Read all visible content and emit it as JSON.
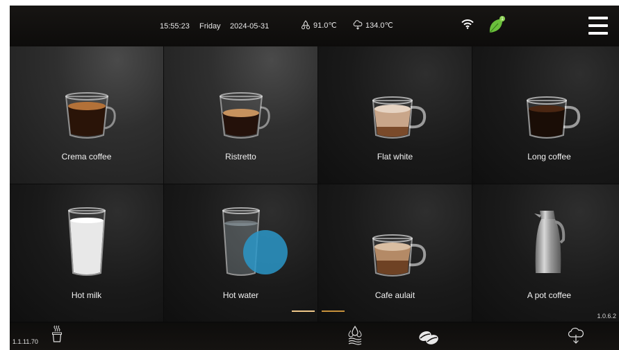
{
  "status_bar": {
    "time": "15:55:23",
    "day": "Friday",
    "date": "2024-05-31",
    "water_temp": "91.0℃",
    "steam_temp": "134.0℃",
    "icons": [
      "water-drops-icon",
      "steam-icon",
      "wifi-icon",
      "eco-leaf-icon",
      "menu-icon"
    ]
  },
  "drinks": [
    {
      "name": "Crema coffee",
      "icon": "espresso-glass-cup-icon"
    },
    {
      "name": "Ristretto",
      "icon": "ristretto-glass-cup-icon"
    },
    {
      "name": "Flat white",
      "icon": "flat-white-mug-icon"
    },
    {
      "name": "Long coffee",
      "icon": "long-coffee-mug-icon"
    },
    {
      "name": "Hot milk",
      "icon": "milk-glass-icon"
    },
    {
      "name": "Hot water",
      "icon": "water-glass-icon"
    },
    {
      "name": "Cafe aulait",
      "icon": "cafe-au-lait-mug-icon"
    },
    {
      "name": "A pot coffee",
      "icon": "coffee-pot-icon"
    }
  ],
  "pagination": {
    "pages": 2,
    "current": 1
  },
  "versions": {
    "firmware_left": "1.1.11.70",
    "app_right": "1.0.6.2"
  },
  "bottom_bar": {
    "icons": [
      "cup-icon",
      "water-heat-icon",
      "coffee-beans-icon",
      "steam-icon"
    ]
  },
  "colors": {
    "accent_active": "#f0c88a",
    "accent_inactive": "#c8923c",
    "touch_indicator": "#2a96c8",
    "leaf": "#6abf3b"
  }
}
